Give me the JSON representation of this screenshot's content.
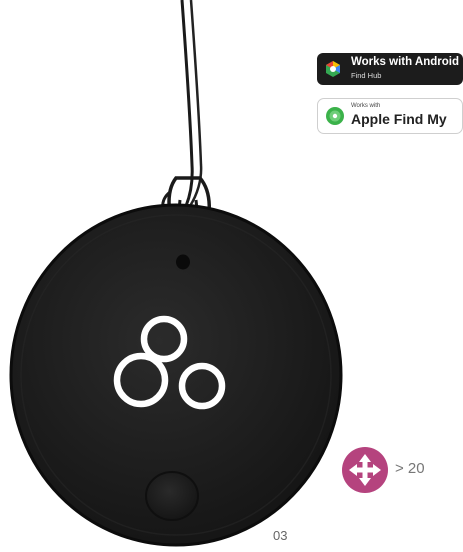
{
  "badges": {
    "android": {
      "title": "Works with Android",
      "subtitle": "Find Hub"
    },
    "apple": {
      "small": "Works with",
      "title": "Apple Find My"
    }
  },
  "quantity": {
    "prefix": ">",
    "value": "20",
    "label": "> 20"
  },
  "page_number": "03",
  "colors": {
    "accent": "#b5437e",
    "tag_body": "#1e1e1e",
    "badge_dark": "#1c1c1c"
  },
  "icons": {
    "move": "move-arrows-icon",
    "cloud": "cloud-logo-icon"
  }
}
